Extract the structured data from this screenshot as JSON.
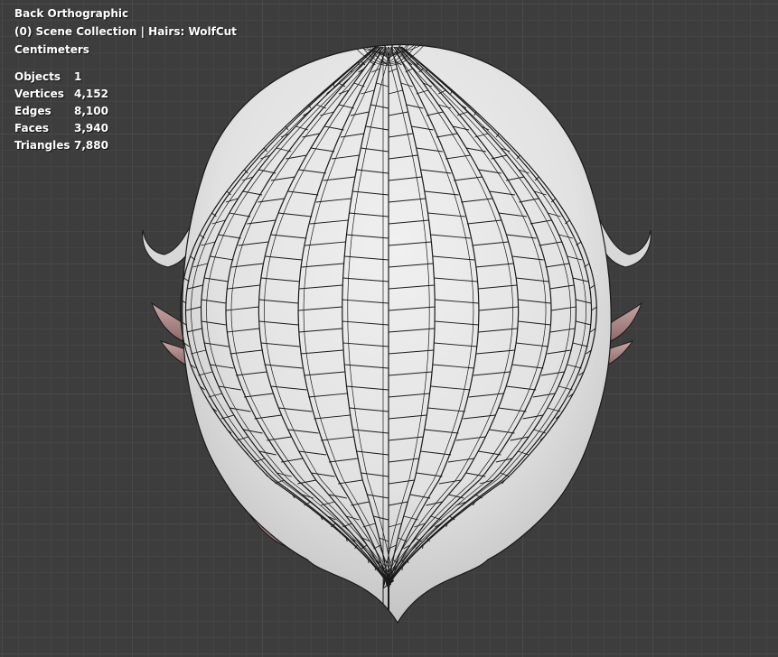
{
  "viewport": {
    "view_name": "Back Orthographic",
    "collection_info": "(0) Scene Collection | Hairs: WolfCut",
    "units": "Centimeters",
    "stats": [
      {
        "label": "Objects",
        "value": "1"
      },
      {
        "label": "Vertices",
        "value": "4,152"
      },
      {
        "label": "Edges",
        "value": "8,100"
      },
      {
        "label": "Faces",
        "value": "3,940"
      },
      {
        "label": "Triangles",
        "value": "7,880"
      }
    ]
  },
  "colors": {
    "background": "#3d3d3d",
    "mesh_fill": "#e4e4e4",
    "mesh_shade": "#c9c9c9",
    "wire": "#1a1a1a",
    "inner_face": "#a98a8a",
    "overlay_text": "#ffffff"
  },
  "mesh": {
    "name": "WolfCut"
  }
}
